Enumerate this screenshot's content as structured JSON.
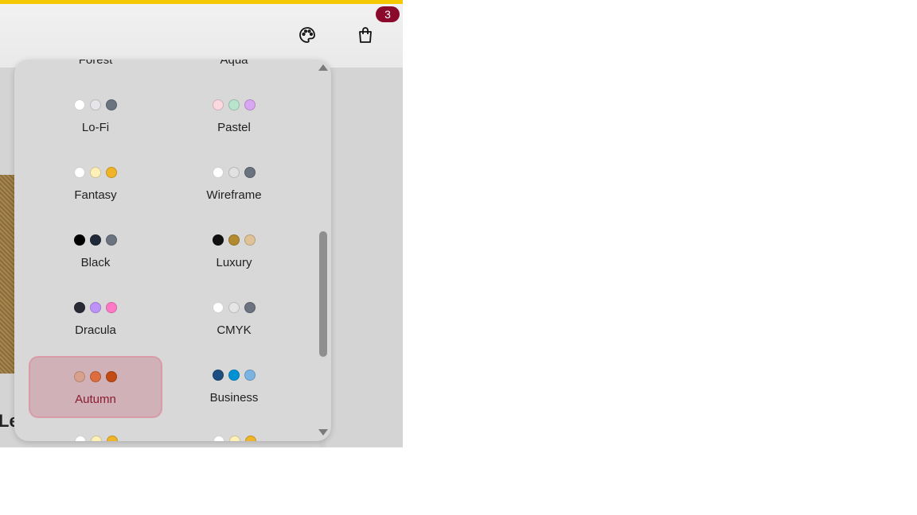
{
  "navbar": {
    "cart_count": "3",
    "palette_icon": "palette-icon",
    "cart_icon": "shopping-bag-icon"
  },
  "product": {
    "title_fragment": "Le"
  },
  "theme_dropdown": {
    "cut_top": [
      "Forest",
      "Aqua"
    ],
    "themes": [
      {
        "name": "Lo-Fi",
        "colors": [
          "#ffffff",
          "#e5e5ea",
          "#6b7280"
        ],
        "active": false
      },
      {
        "name": "Pastel",
        "colors": [
          "#fbd9df",
          "#b8e5cd",
          "#d8a7f3"
        ],
        "active": false
      },
      {
        "name": "Fantasy",
        "colors": [
          "#ffffff",
          "#fff0b8",
          "#f0b429"
        ],
        "active": false
      },
      {
        "name": "Wireframe",
        "colors": [
          "#ffffff",
          "#e1e1e1",
          "#6b7280"
        ],
        "active": false
      },
      {
        "name": "Black",
        "colors": [
          "#000000",
          "#1f2937",
          "#6b7280"
        ],
        "active": false
      },
      {
        "name": "Luxury",
        "colors": [
          "#111111",
          "#b38a2d",
          "#dfc396"
        ],
        "active": false
      },
      {
        "name": "Dracula",
        "colors": [
          "#282a36",
          "#bd93f9",
          "#ff79c6"
        ],
        "active": false
      },
      {
        "name": "CMYK",
        "colors": [
          "#ffffff",
          "#e5e5e5",
          "#6b7280"
        ],
        "active": false
      },
      {
        "name": "Autumn",
        "colors": [
          "#d9a18d",
          "#dd6d3f",
          "#c34b14"
        ],
        "active": true
      },
      {
        "name": "Business",
        "colors": [
          "#1c4e80",
          "#0091d5",
          "#7bb4e3"
        ],
        "active": false
      }
    ],
    "partial_dots": [
      [
        "#ffffff",
        "#fff0b8",
        "#f0b429"
      ],
      [
        "#ffffff",
        "#fff0b8",
        "#f0b429"
      ]
    ]
  }
}
